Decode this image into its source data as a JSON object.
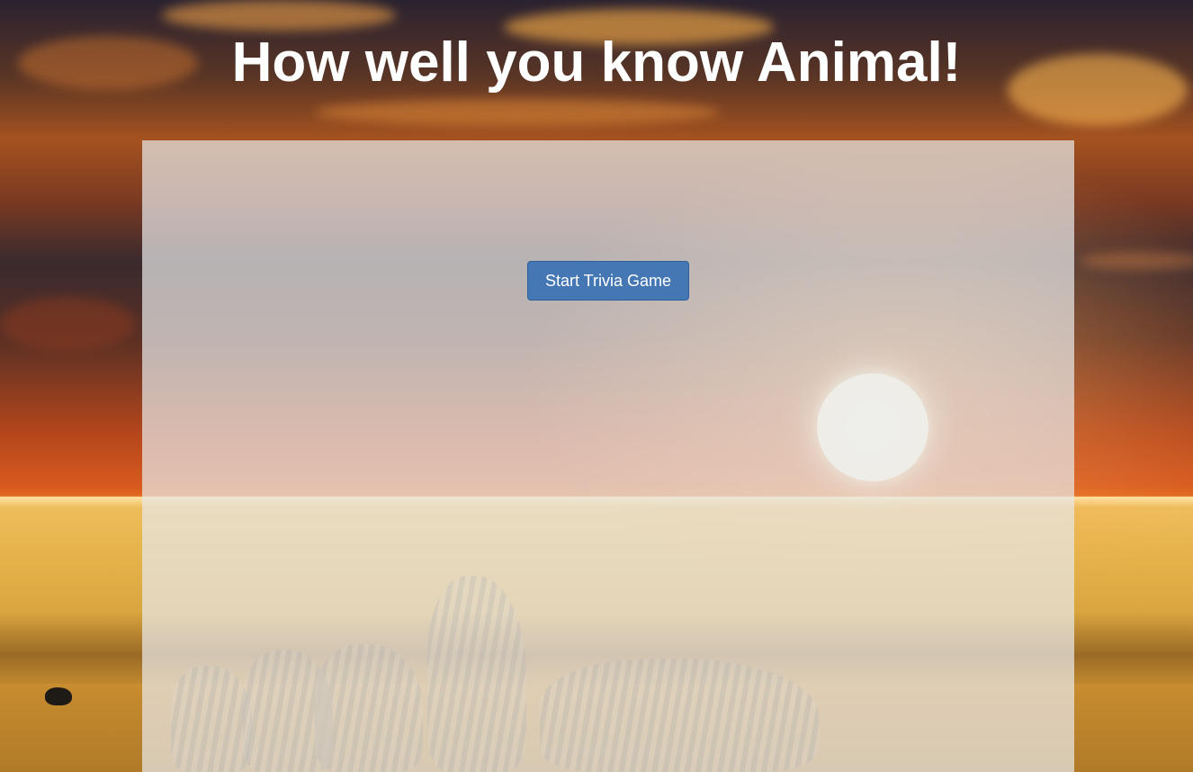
{
  "page": {
    "title": "How well you know Animal!"
  },
  "game": {
    "start_button_label": "Start Trivia Game"
  },
  "colors": {
    "button_background": "#4477b3",
    "title_text": "#ffffff",
    "panel_overlay": "rgba(232,232,232,0.72)"
  },
  "background": {
    "scene": "savanna-sunset-with-zebras"
  }
}
